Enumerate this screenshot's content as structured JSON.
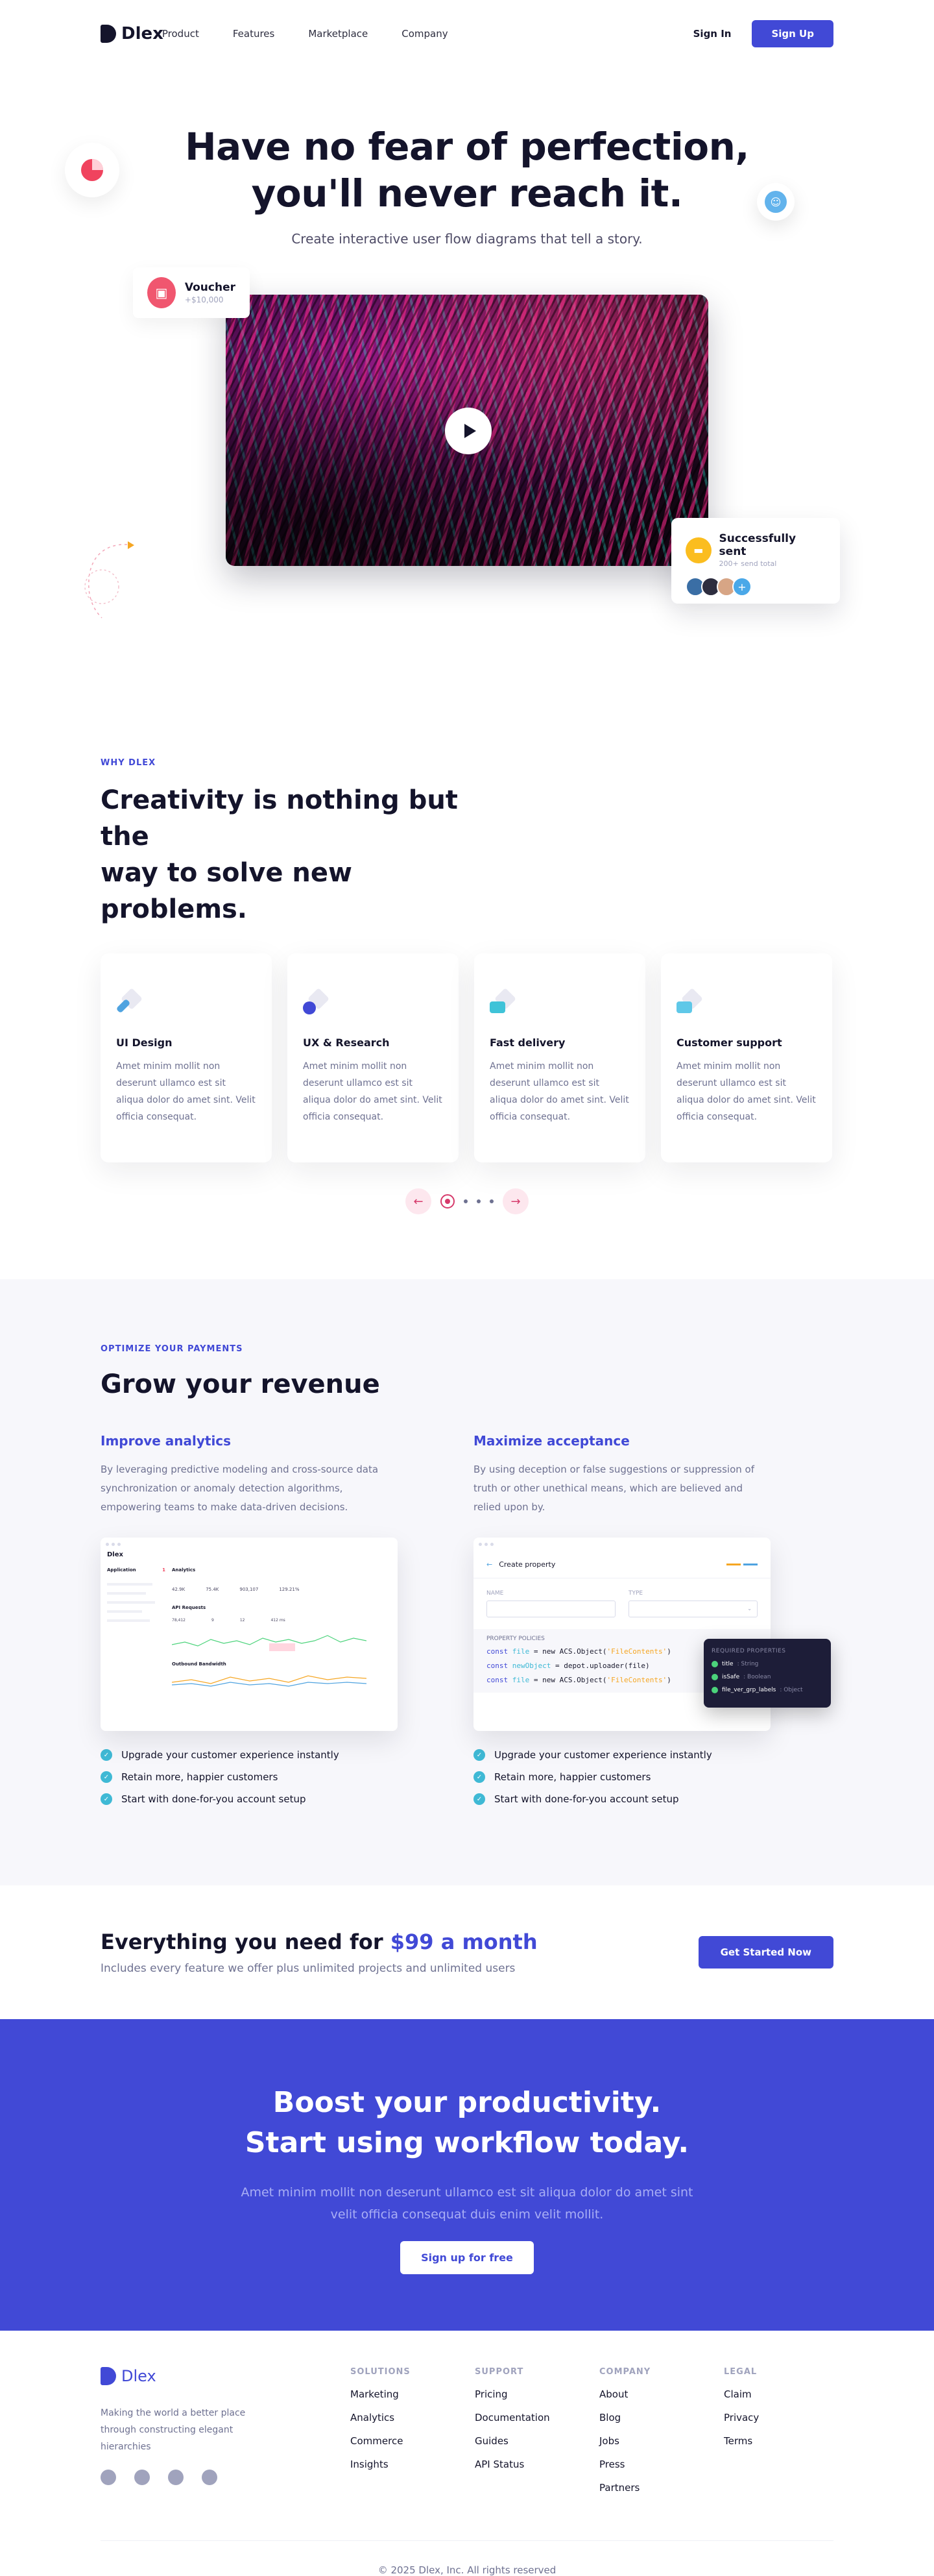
{
  "nav": {
    "brand": "Dlex",
    "links": [
      "Product",
      "Features",
      "Marketplace",
      "Company"
    ],
    "signin": "Sign In",
    "signup": "Sign Up"
  },
  "hero": {
    "title_line1": "Have no fear of perfection,",
    "title_line2": "you'll never reach it.",
    "subtitle": "Create interactive user flow diagrams that tell a story.",
    "voucher_title": "Voucher",
    "voucher_amount": "+$10,000",
    "sent_title": "Successfully sent",
    "sent_sub": "200+ send total",
    "avatar_colors": [
      "#3a6ea5",
      "#2d2d3f",
      "#d7a585",
      "#4aa8e8"
    ]
  },
  "why": {
    "eyebrow": "WHY DLEX",
    "title_line1": "Creativity is nothing but the",
    "title_line2": "way to solve new problems.",
    "cards": [
      {
        "title": "UI Design",
        "text": "Amet minim mollit non deserunt ullamco est sit aliqua dolor do amet sint. Velit officia consequat.",
        "icon": "pen-icon",
        "color": "#4fa3e0"
      },
      {
        "title": "UX & Research",
        "text": "Amet minim mollit non deserunt ullamco est sit aliqua dolor do amet sint. Velit officia consequat.",
        "icon": "circle-icon",
        "color": "#4149d6"
      },
      {
        "title": "Fast delivery",
        "text": "Amet minim mollit non deserunt ullamco est sit aliqua dolor do amet sint. Velit officia consequat.",
        "icon": "truck-icon",
        "color": "#3fc3d8"
      },
      {
        "title": "Customer support",
        "text": "Amet minim mollit non deserunt ullamco est sit aliqua dolor do amet sint. Velit officia consequat.",
        "icon": "chat-icon",
        "color": "#5fc8e8"
      }
    ],
    "prev": "←",
    "next": "→"
  },
  "revenue": {
    "eyebrow": "OPTIMIZE YOUR PAYMENTS",
    "title": "Grow your revenue",
    "left": {
      "title": "Improve analytics",
      "text": "By leveraging predictive modeling and cross-source data synchronization or anomaly detection algorithms, empowering teams to make data-driven decisions.",
      "mock": {
        "brand": "Dlex",
        "app": "Application",
        "app_badge": "1",
        "section": "Analytics",
        "sub": "API Requests",
        "sub2": "Outbound Bandwidth",
        "stats": [
          "42.9K",
          "75.4K",
          "903,107",
          "129.21%"
        ],
        "mini": [
          "78,412",
          "9",
          "12",
          "412 ms"
        ]
      },
      "checks": [
        "Upgrade your customer experience instantly",
        "Retain more, happier customers",
        "Start with done-for-you account setup"
      ]
    },
    "right": {
      "title": "Maximize acceptance",
      "text": "By using deception or false suggestions or suppression of truth or other unethical means, which are believed and relied upon by.",
      "mock": {
        "header": "Create property",
        "name_label": "NAME",
        "type_label": "TYPE",
        "section": "PROPERTY POLICIES",
        "code": [
          {
            "kw": "const",
            "var": "file",
            "rest": " = new ACS.Object(",
            "str": "'FileContents'",
            "end": ")"
          },
          {
            "kw": "const",
            "var": "newObject",
            "rest": " = depot.uploader(file)",
            "str": "",
            "end": ""
          },
          {
            "kw": "const",
            "var": "file",
            "rest": " = new ACS.Object(",
            "str": "'FileContents'",
            "end": ")"
          }
        ],
        "popover_title": "REQUIRED PROPERTIES",
        "popover_rows": [
          "title",
          "isSafe",
          "file_ver_grp_labels"
        ],
        "popover_types": [
          ": String",
          ": Boolean",
          ": Object"
        ]
      },
      "checks": [
        "Upgrade your customer experience instantly",
        "Retain more, happier customers",
        "Start with done-for-you account setup"
      ]
    }
  },
  "pricing": {
    "title_pre": "Everything you need for ",
    "title_price": "$99 a month",
    "subtitle": "Includes every feature we offer plus unlimited projects and unlimited users",
    "cta": "Get Started Now"
  },
  "cta": {
    "title_line1": "Boost your productivity.",
    "title_line2": "Start using workflow today.",
    "text_line1": "Amet minim mollit non deserunt ullamco est sit aliqua dolor do amet sint",
    "text_line2": "velit officia consequat duis enim velit mollit.",
    "button": "Sign up for free"
  },
  "footer": {
    "brand": "Dlex",
    "tagline": "Making the world a better place through constructing elegant hierarchies",
    "social": [
      "facebook-icon",
      "twitter-icon",
      "instagram-icon",
      "github-icon"
    ],
    "columns": [
      {
        "title": "SOLUTIONS",
        "items": [
          "Marketing",
          "Analytics",
          "Commerce",
          "Insights"
        ]
      },
      {
        "title": "SUPPORT",
        "items": [
          "Pricing",
          "Documentation",
          "Guides",
          "API Status"
        ]
      },
      {
        "title": "COMPANY",
        "items": [
          "About",
          "Blog",
          "Jobs",
          "Press",
          "Partners"
        ]
      },
      {
        "title": "LEGAL",
        "items": [
          "Claim",
          "Privacy",
          "Terms"
        ]
      }
    ],
    "copyright": "© 2025 Dlex, Inc. All rights reserved"
  }
}
